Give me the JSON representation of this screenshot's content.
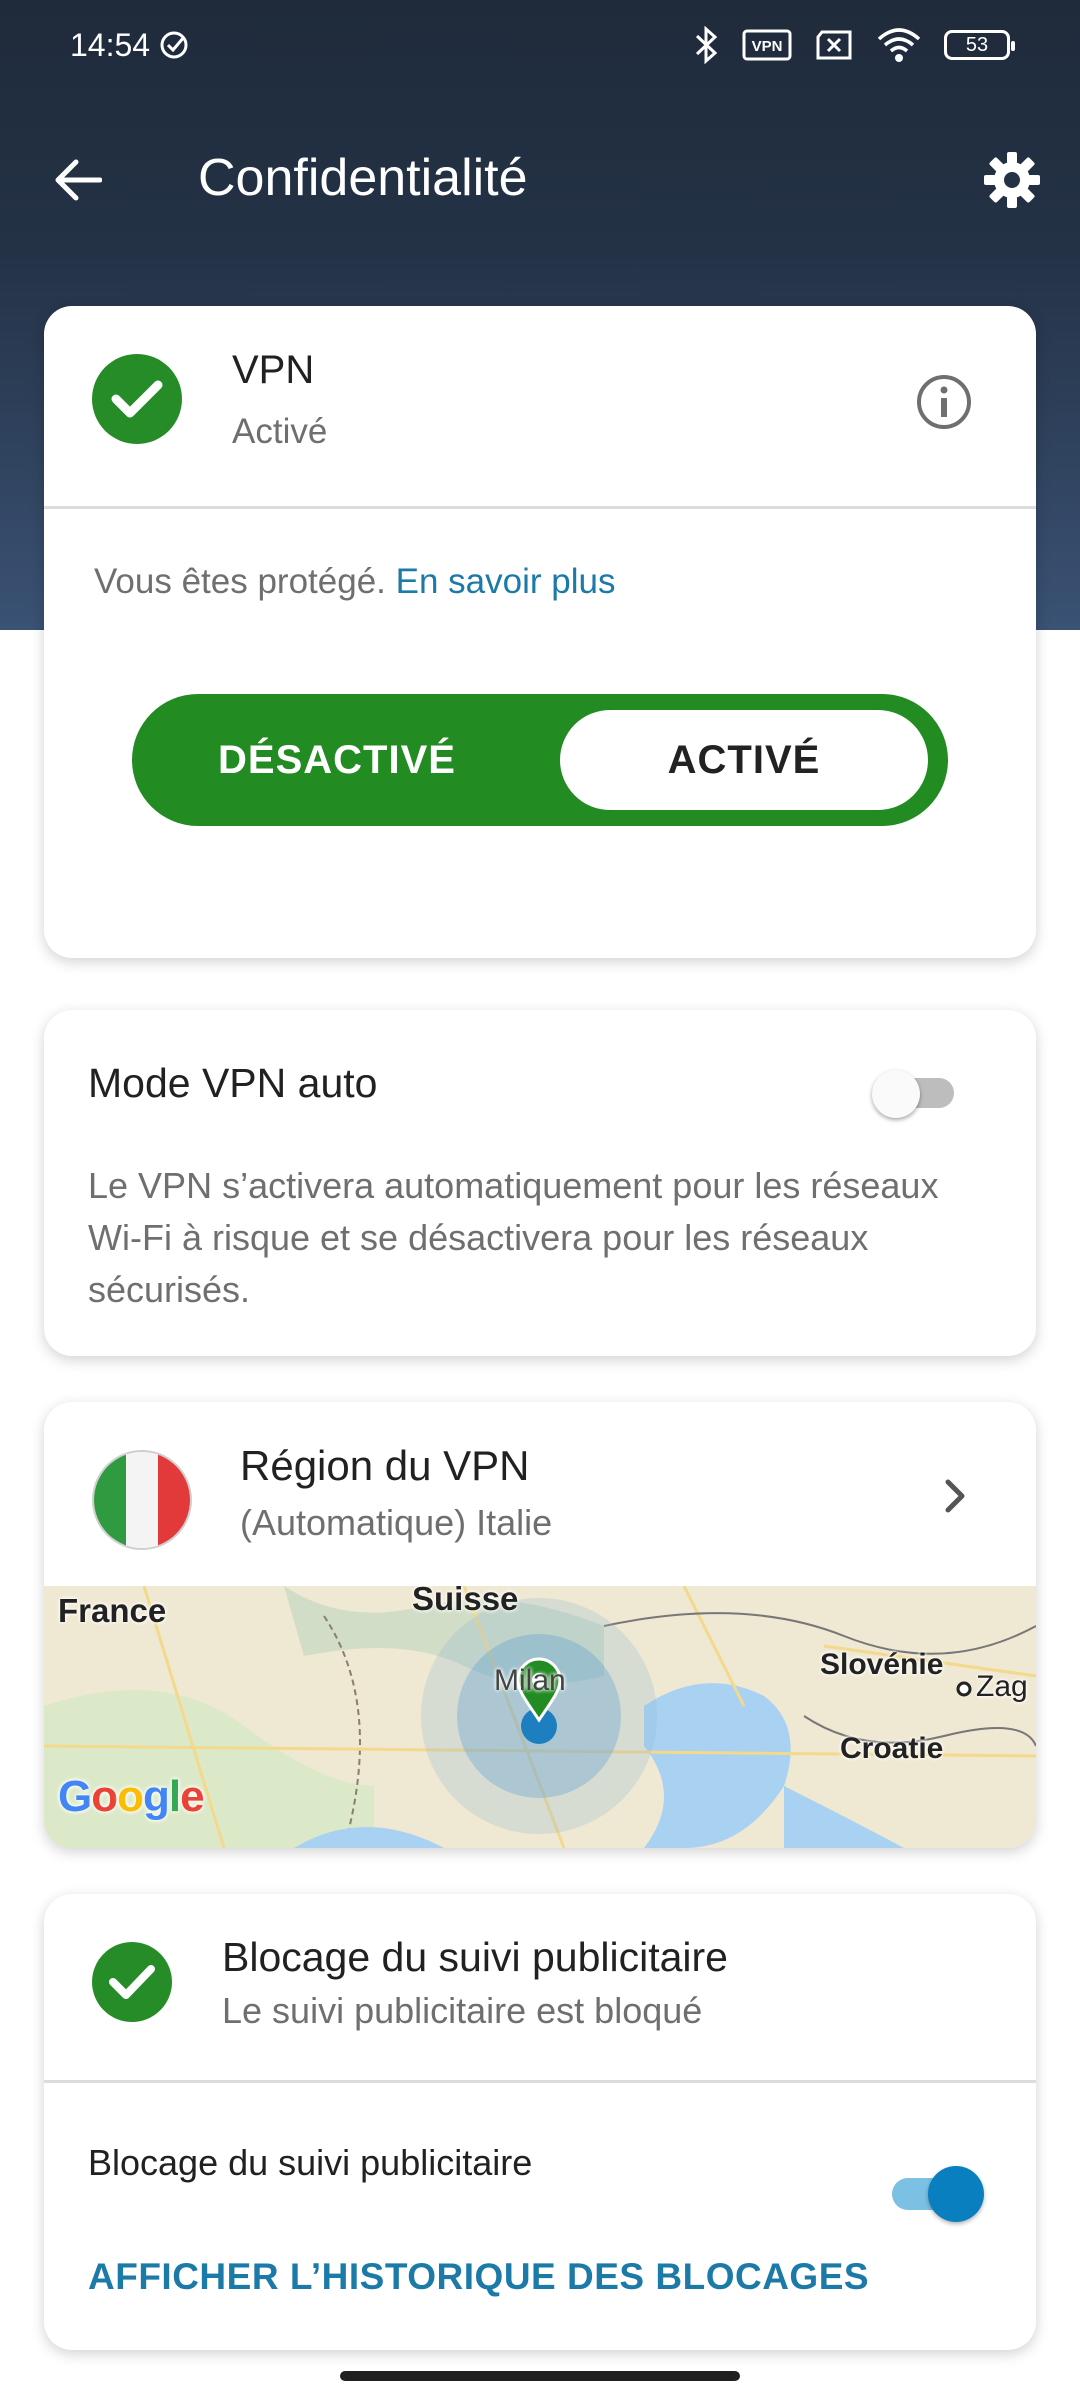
{
  "status_bar": {
    "time": "14:54",
    "battery": "53",
    "icons": [
      "check-circle-icon",
      "bluetooth-icon",
      "vpn-key-icon",
      "no-sim-icon",
      "wifi-icon",
      "battery-icon"
    ],
    "vpn_badge": "VPN"
  },
  "appbar": {
    "title": "Confidentialité",
    "back_icon": "arrow-back-icon",
    "settings_icon": "gear-icon"
  },
  "vpn_card": {
    "title": "VPN",
    "status": "Activé",
    "protected_text": "Vous êtes protégé.",
    "learn_more": "En savoir plus",
    "toggle_off_label": "DÉSACTIVÉ",
    "toggle_on_label": "ACTIVÉ",
    "selected": "ACTIVÉ"
  },
  "auto_vpn_card": {
    "title": "Mode VPN auto",
    "enabled": false,
    "description": "Le VPN s’activera automatiquement pour les réseaux Wi-Fi à risque et se désactivera pour les réseaux sécurisés."
  },
  "region_card": {
    "title": "Région du VPN",
    "subtitle": "(Automatique) Italie",
    "map_labels": {
      "france": "France",
      "suisse": "Suisse",
      "milan": "Milan",
      "slovenie": "Slovénie",
      "zagreb": "Zag",
      "croatie": "Croatie"
    },
    "map_logo": "Google",
    "flag_colors": [
      "#2f9a3f",
      "#f4f4f4",
      "#e23a3a"
    ]
  },
  "ads_card": {
    "title": "Blocage du suivi publicitaire",
    "subtitle": "Le suivi publicitaire est bloqué",
    "row_label": "Blocage du suivi publicitaire",
    "enabled": true,
    "history_link": "AFFICHER L’HISTORIQUE DES BLOCAGES"
  },
  "colors": {
    "accent_green": "#258c27",
    "link_blue": "#1c7aa8",
    "switch_on": "#0a7fc0",
    "header_dark": "#1f2b3b"
  }
}
